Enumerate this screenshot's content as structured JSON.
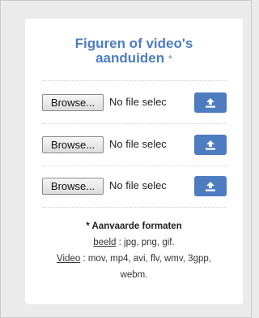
{
  "title": {
    "line1": "Figuren of video's",
    "line2": "aanduiden",
    "required_marker": "*"
  },
  "uploads": [
    {
      "browse_label": "Browse...",
      "file_status": "No file selec",
      "upload_icon": "upload-icon"
    },
    {
      "browse_label": "Browse...",
      "file_status": "No file selec",
      "upload_icon": "upload-icon"
    },
    {
      "browse_label": "Browse...",
      "file_status": "No file selec",
      "upload_icon": "upload-icon"
    }
  ],
  "formats": {
    "header": "* Aanvaarde formaten",
    "image_label": "beeld",
    "image_list": " : jpg, png, gif.",
    "video_label": "Video",
    "video_list_line1": " : mov, mp4, avi, flv, wmv, 3gpp,",
    "video_list_line2": "webm."
  },
  "colors": {
    "accent": "#4d7cc0",
    "background": "#ebebeb",
    "card": "#ffffff"
  }
}
